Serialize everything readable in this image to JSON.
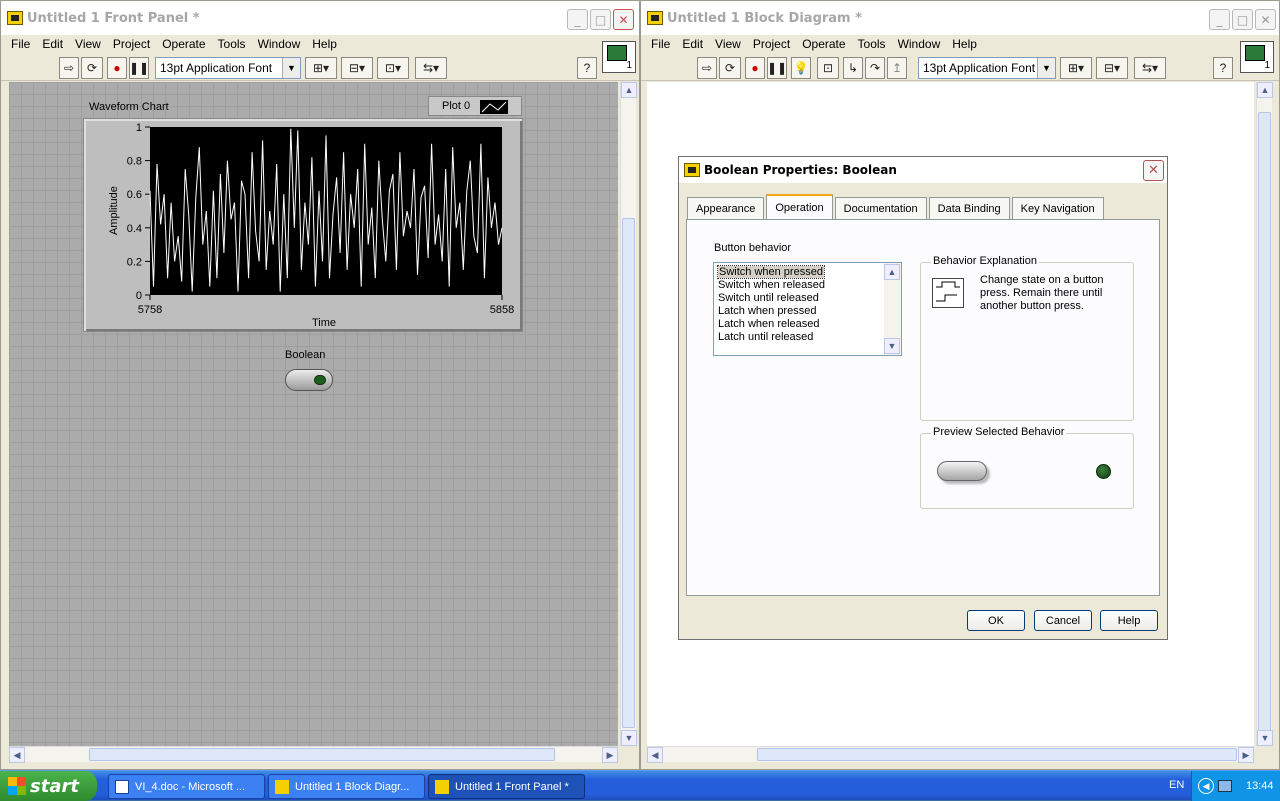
{
  "front_panel": {
    "title": "Untitled 1 Front Panel *",
    "menu": [
      "File",
      "Edit",
      "View",
      "Project",
      "Operate",
      "Tools",
      "Window",
      "Help"
    ],
    "font_select": "13pt Application Font",
    "chart": {
      "label": "Waveform Chart",
      "legend_label": "Plot 0",
      "y_label": "Amplitude",
      "x_label": "Time",
      "y_ticks": [
        "1",
        "0.8",
        "0.6",
        "0.4",
        "0.2",
        "0"
      ],
      "x_ticks": [
        "5758",
        "5858"
      ]
    },
    "boolean_label": "Boolean"
  },
  "chart_data": {
    "type": "line",
    "xlabel": "Time",
    "ylabel": "Amplitude",
    "xlim": [
      5758,
      5858
    ],
    "ylim": [
      0,
      1
    ],
    "series": [
      {
        "name": "Plot 0",
        "color": "#ffffff",
        "values": [
          0.62,
          0.05,
          0.78,
          0.42,
          0.6,
          0.1,
          0.55,
          0.2,
          0.35,
          0.08,
          0.75,
          0.48,
          0.02,
          0.58,
          0.88,
          0.3,
          0.5,
          0.05,
          0.62,
          0.1,
          0.72,
          0.25,
          0.8,
          0.45,
          0.55,
          0.02,
          0.68,
          0.6,
          0.1,
          0.85,
          0.38,
          0.2,
          0.92,
          0.15,
          0.5,
          0.3,
          0.78,
          0.02,
          0.6,
          0.1,
          0.99,
          0.4,
          0.98,
          0.15,
          0.55,
          0.3,
          0.82,
          0.05,
          0.62,
          0.2,
          0.95,
          0.1,
          0.48,
          0.7,
          0.25,
          0.85,
          0.15,
          0.6,
          0.4,
          0.75,
          0.05,
          0.9,
          0.3,
          0.52,
          0.1,
          0.8,
          0.45,
          0.2,
          0.62,
          0.72,
          0.15,
          0.85,
          0.35,
          0.5,
          0.4,
          0.75,
          0.12,
          0.58,
          0.65,
          0.22,
          0.9,
          0.3,
          0.48,
          0.2,
          0.75,
          0.05,
          0.88,
          0.4,
          0.55,
          0.15,
          0.62,
          0.8,
          0.35,
          0.25,
          0.9,
          0.1,
          0.7,
          0.4,
          0.55,
          0.3,
          0.4
        ]
      }
    ]
  },
  "block_diagram": {
    "title": "Untitled 1 Block Diagram *",
    "menu": [
      "File",
      "Edit",
      "View",
      "Project",
      "Operate",
      "Tools",
      "Window",
      "Help"
    ],
    "font_select": "13pt Application Font"
  },
  "dialog": {
    "title": "Boolean Properties: Boolean",
    "tabs": [
      "Appearance",
      "Operation",
      "Documentation",
      "Data Binding",
      "Key Navigation"
    ],
    "active_tab": "Operation",
    "button_behavior_label": "Button behavior",
    "behaviors": [
      "Switch when pressed",
      "Switch when released",
      "Switch until released",
      "Latch when pressed",
      "Latch when released",
      "Latch until released"
    ],
    "selected_behavior": "Switch when pressed",
    "explanation_title": "Behavior Explanation",
    "explanation_text": "Change state on a button press.  Remain there until another button press.",
    "preview_title": "Preview Selected Behavior",
    "ok": "OK",
    "cancel": "Cancel",
    "help": "Help"
  },
  "taskbar": {
    "start": "start",
    "tasks": [
      "VI_4.doc - Microsoft ...",
      "Untitled 1 Block Diagr...",
      "Untitled 1 Front Panel *"
    ],
    "lang": "EN",
    "clock": "13:44"
  }
}
